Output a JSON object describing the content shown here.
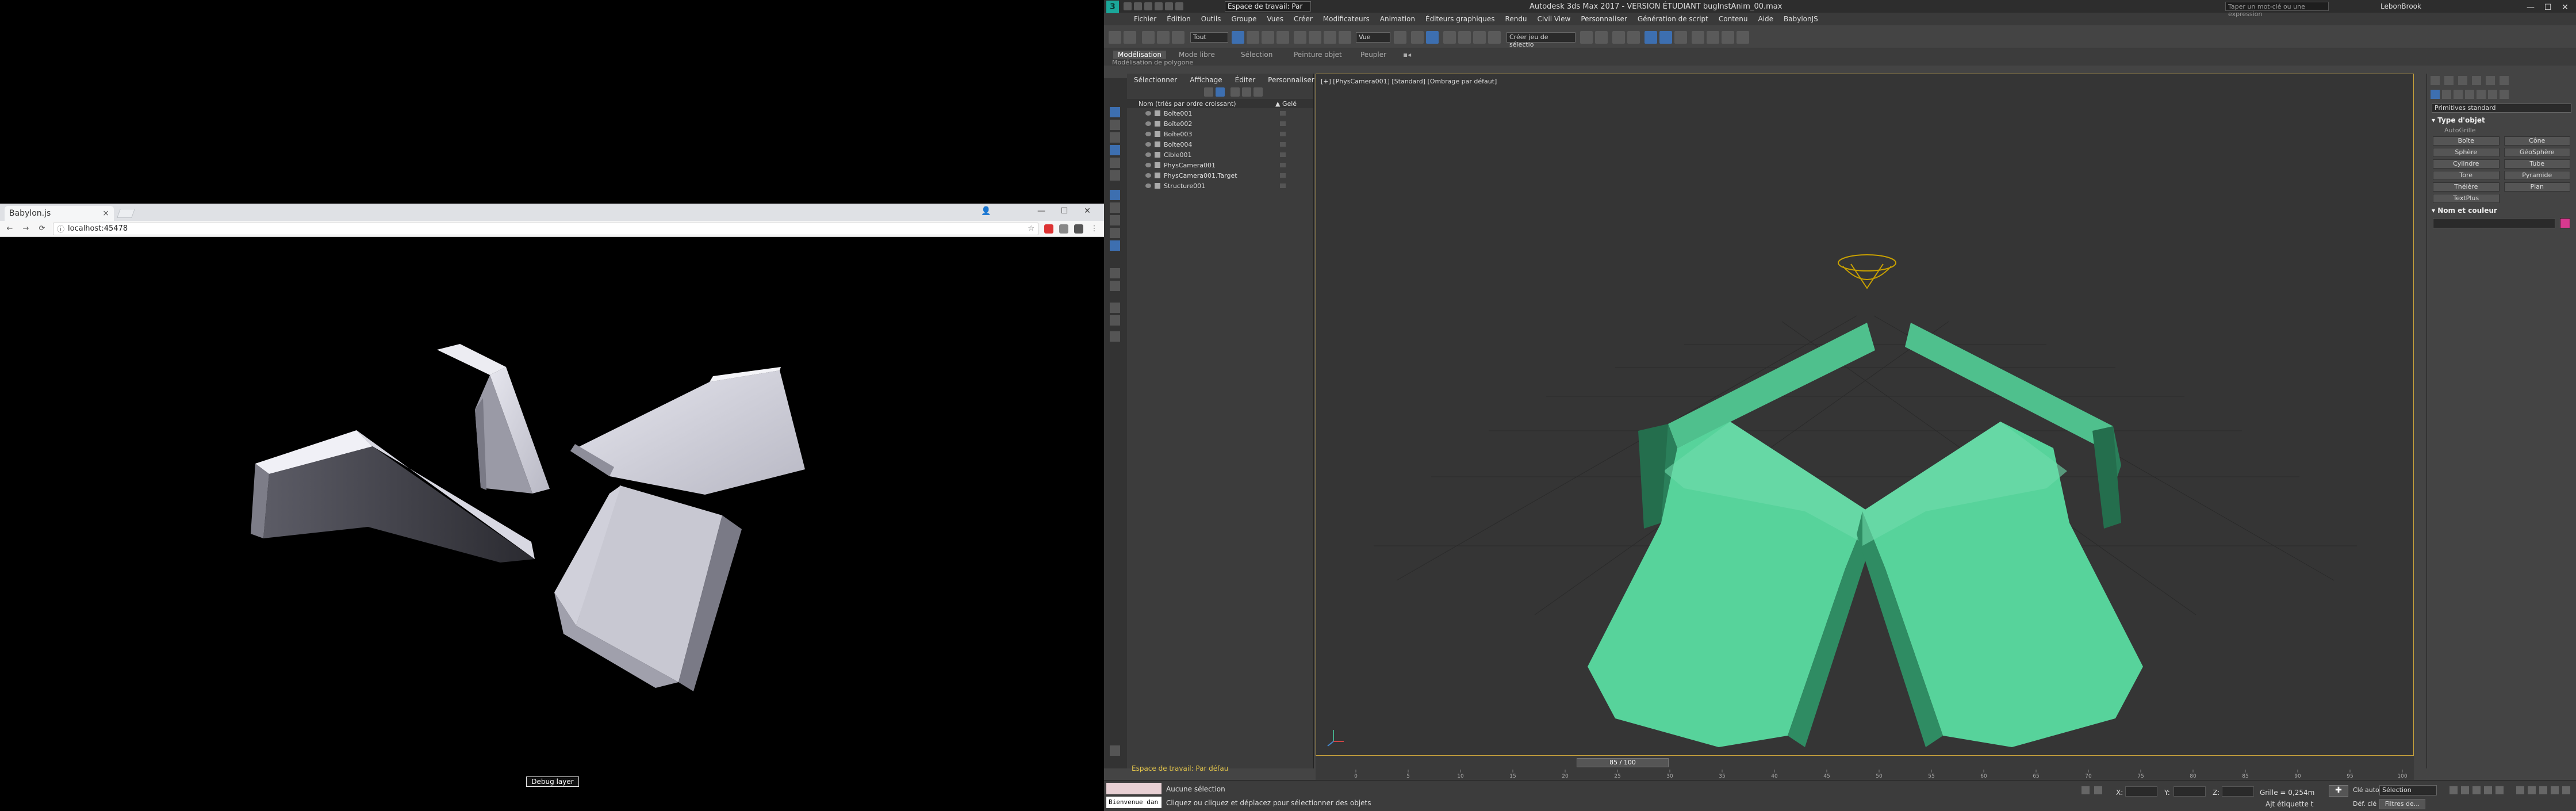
{
  "browser": {
    "tab_title": "Babylon.js",
    "tab_close": "×",
    "url": "localhost:45478",
    "nav_back": "←",
    "nav_forward": "→",
    "nav_reload": "⟳",
    "win_min": "—",
    "win_max": "☐",
    "win_close": "✕",
    "debug_button": "Debug layer"
  },
  "max": {
    "title": "Autodesk 3ds Max 2017 - VERSION ÉTUDIANT   bugInstAnim_00.max",
    "workspace": "Espace de travail: Par",
    "search_placeholder": "Taper un mot-clé ou une expression",
    "user": "LebonBrook",
    "menu": [
      "Fichier",
      "Édition",
      "Outils",
      "Groupe",
      "Vues",
      "Créer",
      "Modificateurs",
      "Animation",
      "Éditeurs graphiques",
      "Rendu",
      "Civil View",
      "Personnaliser",
      "Génération de script",
      "Contenu",
      "Aide",
      "BabylonJS"
    ],
    "toolbar": {
      "selection_filter": "Tout",
      "ref_coord": "Vue",
      "named_selection": "Créer jeu de sélectio"
    },
    "ribbon": {
      "tabs": [
        "Modélisation",
        "Mode libre",
        "Sélection",
        "Peinture objet",
        "Peupler"
      ],
      "active_tab": "Modélisation",
      "sub_label": "Modélisation de polygone"
    },
    "explorer": {
      "menu": [
        "Sélectionner",
        "Affichage",
        "Éditer",
        "Personnaliser"
      ],
      "header_name": "Nom (triés par ordre croissant)",
      "header_frozen": "▲ Gelé",
      "items": [
        "Boîte001",
        "Boîte002",
        "Boîte003",
        "Boîte004",
        "Cible001",
        "PhysCamera001",
        "PhysCamera001.Target",
        "Structure001"
      ]
    },
    "viewport_label": "[+] [PhysCamera001] [Standard] [Ombrage par défaut]",
    "command_panel": {
      "category": "Primitives standard",
      "rollout_type": "▾ Type d'objet",
      "autogrid": "AutoGrille",
      "buttons": [
        "Boîte",
        "Cône",
        "Sphère",
        "GéoSphère",
        "Cylindre",
        "Tube",
        "Tore",
        "Pyramide",
        "Théière",
        "Plan",
        "TextPlus"
      ],
      "rollout_name": "▾ Nom et couleur",
      "swatch_color": "#d8398f"
    },
    "timeline": {
      "slider": "85 / 100",
      "ticks": [
        "0",
        "5",
        "10",
        "15",
        "20",
        "25",
        "30",
        "35",
        "40",
        "45",
        "50",
        "55",
        "60",
        "65",
        "70",
        "75",
        "80",
        "85",
        "90",
        "95",
        "100"
      ]
    },
    "status": {
      "workspace_label": "Espace de travail: Par défau",
      "welcome": "Bienvenue dan",
      "selection": "Aucune sélection",
      "prompt": "Cliquez ou cliquez et déplacez pour sélectionner des objets",
      "x_label": "X:",
      "y_label": "Y:",
      "z_label": "Z:",
      "grid": "Grille = 0,254m",
      "add_tag": "Ajt étiquette t",
      "auto_label": "Clé auto",
      "selection_field": "Sélection",
      "def_label": "Déf. clé",
      "filters": "Filtres de..."
    }
  }
}
